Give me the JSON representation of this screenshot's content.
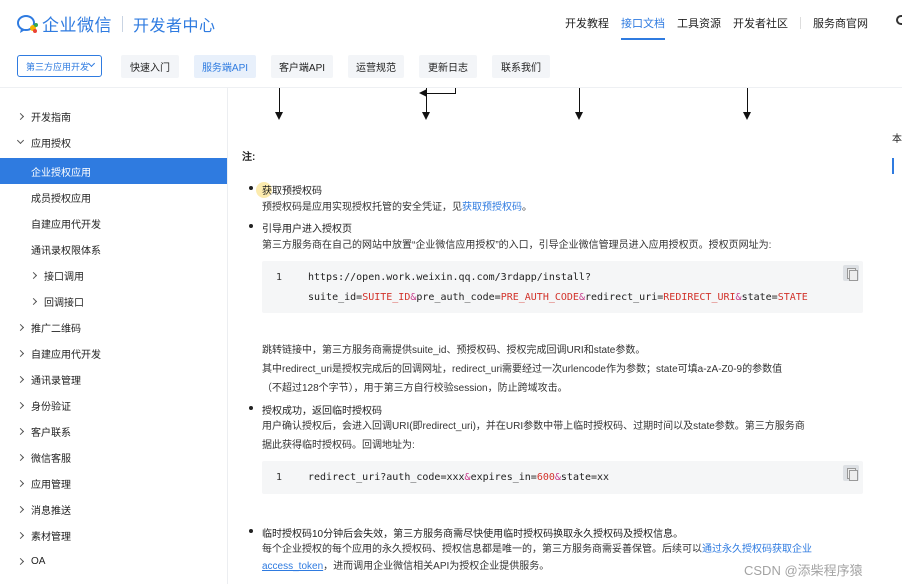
{
  "header": {
    "logo_text": "企业微信",
    "logo_subtitle": "开发者中心",
    "nav": [
      "开发教程",
      "接口文档",
      "工具资源",
      "开发者社区",
      "服务商官网"
    ],
    "active_nav": "接口文档"
  },
  "subbar": {
    "dropdown_label": "第三方应用开发",
    "tabs": [
      "快速入门",
      "服务端API",
      "客户端API",
      "运营规范",
      "更新日志",
      "联系我们"
    ],
    "active_tab": "服务端API"
  },
  "sidebar": {
    "items": [
      {
        "label": "开发指南",
        "caret": "right",
        "level": 0
      },
      {
        "label": "应用授权",
        "caret": "down",
        "level": 0
      },
      {
        "label": "企业授权应用",
        "caret": "",
        "level": 1,
        "active": true
      },
      {
        "label": "成员授权应用",
        "caret": "",
        "level": 1
      },
      {
        "label": "自建应用代开发",
        "caret": "",
        "level": 1
      },
      {
        "label": "通讯录权限体系",
        "caret": "",
        "level": 1
      },
      {
        "label": "接口调用",
        "caret": "right",
        "level": 1
      },
      {
        "label": "回调接口",
        "caret": "right",
        "level": 1
      },
      {
        "label": "推广二维码",
        "caret": "right",
        "level": 0
      },
      {
        "label": "自建应用代开发",
        "caret": "right",
        "level": 0
      },
      {
        "label": "通讯录管理",
        "caret": "right",
        "level": 0
      },
      {
        "label": "身份验证",
        "caret": "right",
        "level": 0
      },
      {
        "label": "客户联系",
        "caret": "right",
        "level": 0
      },
      {
        "label": "微信客服",
        "caret": "right",
        "level": 0
      },
      {
        "label": "应用管理",
        "caret": "right",
        "level": 0
      },
      {
        "label": "消息推送",
        "caret": "right",
        "level": 0
      },
      {
        "label": "素材管理",
        "caret": "right",
        "level": 0
      },
      {
        "label": "OA",
        "caret": "right",
        "level": 0
      }
    ]
  },
  "main": {
    "note_label": "注:",
    "step1": {
      "title": "获取预授权码",
      "desc_before": "预授权码是应用实现授权托管的安全凭证，见",
      "desc_link": "获取预授权码",
      "desc_after": "。"
    },
    "step2": {
      "title": "引导用户进入授权页",
      "desc": "第三方服务商在自己的网站中放置“企业微信应用授权”的入口，引导企业微信管理员进入应用授权页。授权页网址为:",
      "code_line_no": "1",
      "after1": "跳转链接中，第三方服务商需提供suite_id、预授权码、授权完成回调URI和state参数。",
      "after2": "其中redirect_uri是授权完成后的回调网址，redirect_uri需要经过一次urlencode作为参数；state可填a-zA-Z0-9的参数值",
      "after3": "（不超过128个字节），用于第三方自行校验session，防止跨域攻击。"
    },
    "step3": {
      "title": "授权成功，返回临时授权码",
      "desc1": "用户确认授权后，会进入回调URI(即redirect_uri)，并在URI参数中带上临时授权码、过期时间以及state参数。第三方服务商",
      "desc2": "据此获得临时授权码。回调地址为:",
      "code_line_no": "1"
    },
    "step4": {
      "title": "临时授权码10分钟后会失效，第三方服务商需尽快使用临时授权码换取永久授权码及授权信息。",
      "desc_before": "每个企业授权的每个应用的永久授权码、授权信息都是唯一的，第三方服务商需妥善保管。后续可以",
      "desc_link": "通过永久授权码获取企业",
      "desc_link2": "access_token",
      "desc_after": "，进而调用企业微信相关API为授权企业提供服务。"
    }
  },
  "code1": {
    "l1_a": "https://open.work.weixin.qq.com/3rdapp/install?",
    "l2_k1": "suite_id=",
    "l2_v1": "SUITE_ID",
    "l2_amp1": "&",
    "l2_k2": "pre_auth_code=",
    "l2_v2": "PRE_AUTH_CODE",
    "l2_amp2": "&",
    "l2_k3": "redirect_uri=",
    "l2_v3": "REDIRECT_URI",
    "l2_amp3": "&",
    "l2_k4": "state=",
    "l2_v4": "STATE"
  },
  "code2": {
    "k1": "redirect_uri?auth_code=xxx",
    "amp1": "&",
    "k2": "expires_in=",
    "v2": "600",
    "amp2": "&",
    "k3": "state=xx"
  },
  "right_panel": {
    "label": "本"
  },
  "watermark": "CSDN @添柴程序猿",
  "colors": {
    "accent": "#2f7be0",
    "code_value": "#d2332b",
    "code_param": "#c73e8c"
  }
}
